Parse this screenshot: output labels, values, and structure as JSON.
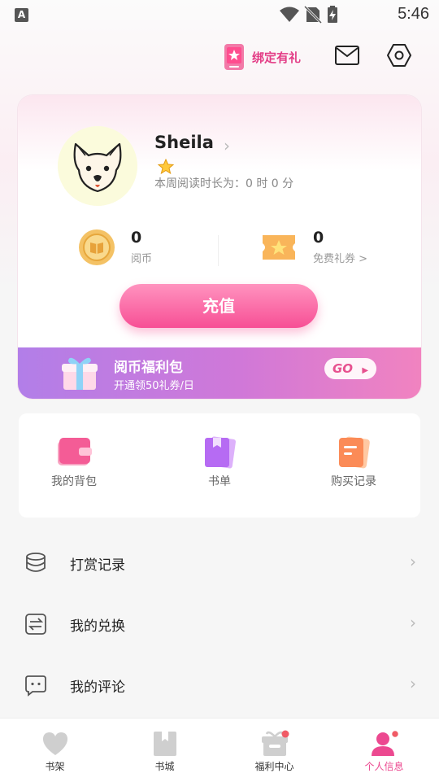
{
  "status_bar": {
    "left_icon": "A",
    "time": "5:46",
    "icons": [
      "wifi-icon",
      "no-sim-icon",
      "battery-charging-icon"
    ]
  },
  "header": {
    "bind_gift_label": "绑定有礼",
    "icons": [
      "phone-gift-icon",
      "mail-icon",
      "settings-icon"
    ]
  },
  "profile": {
    "username": "Sheila",
    "reading_time_text": "本周阅读时长为：0 时 0 分",
    "stats": {
      "coins_value": "0",
      "coins_label": "阅币",
      "vouchers_value": "0",
      "vouchers_label": "免费礼券 >"
    },
    "recharge_label": "充值"
  },
  "welfare_banner": {
    "title": "阅币福利包",
    "subtitle": "开通领50礼券/日",
    "go_label": "GO"
  },
  "quick_actions": [
    {
      "label": "我的背包",
      "icon": "wallet-icon"
    },
    {
      "label": "书单",
      "icon": "booklist-icon"
    },
    {
      "label": "购买记录",
      "icon": "purchase-record-icon"
    }
  ],
  "menu": [
    {
      "label": "打赏记录",
      "icon": "coin-stack-icon"
    },
    {
      "label": "我的兑换",
      "icon": "exchange-icon"
    },
    {
      "label": "我的评论",
      "icon": "comment-icon"
    }
  ],
  "bottom_nav": [
    {
      "label": "书架",
      "icon": "heart-icon",
      "active": false
    },
    {
      "label": "书城",
      "icon": "book-icon",
      "active": false
    },
    {
      "label": "福利中心",
      "icon": "gift-icon",
      "active": false
    },
    {
      "label": "个人信息",
      "icon": "person-icon",
      "active": true
    }
  ],
  "colors": {
    "accent": "#ec4990",
    "banner_start": "#b27ee8",
    "banner_end": "#f183c0"
  }
}
